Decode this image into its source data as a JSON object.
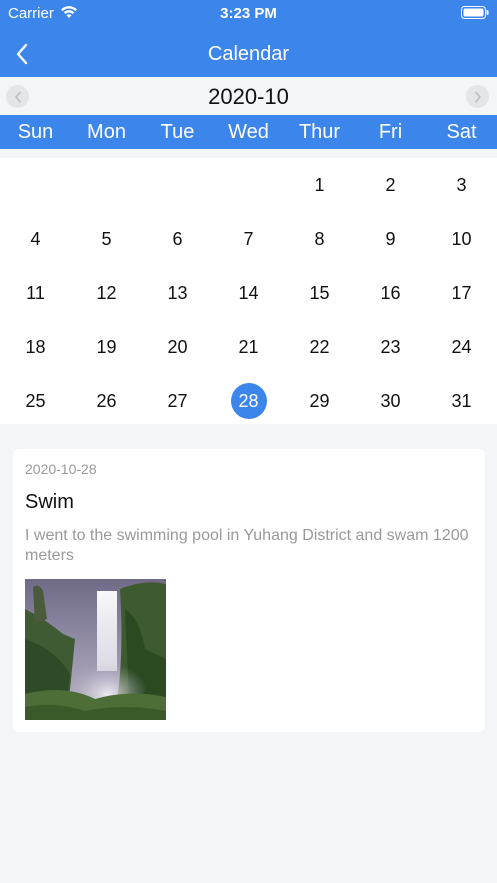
{
  "status": {
    "carrier": "Carrier",
    "time": "3:23 PM"
  },
  "nav": {
    "title": "Calendar"
  },
  "month": {
    "label": "2020-10"
  },
  "weekdays": [
    "Sun",
    "Mon",
    "Tue",
    "Wed",
    "Thur",
    "Fri",
    "Sat"
  ],
  "calendar": {
    "days": [
      "",
      "",
      "",
      "",
      "1",
      "2",
      "3",
      "4",
      "5",
      "6",
      "7",
      "8",
      "9",
      "10",
      "11",
      "12",
      "13",
      "14",
      "15",
      "16",
      "17",
      "18",
      "19",
      "20",
      "21",
      "22",
      "23",
      "24",
      "25",
      "26",
      "27",
      "28",
      "29",
      "30",
      "31"
    ],
    "selected": "28"
  },
  "entry": {
    "date": "2020-10-28",
    "title": "Swim",
    "description": "I went to the swimming pool in Yuhang District and swam 1200 meters",
    "photo_icon": "waterfall-photo"
  },
  "colors": {
    "accent": "#3c85ea",
    "background": "#f4f5f7",
    "muted_text": "#999999"
  }
}
